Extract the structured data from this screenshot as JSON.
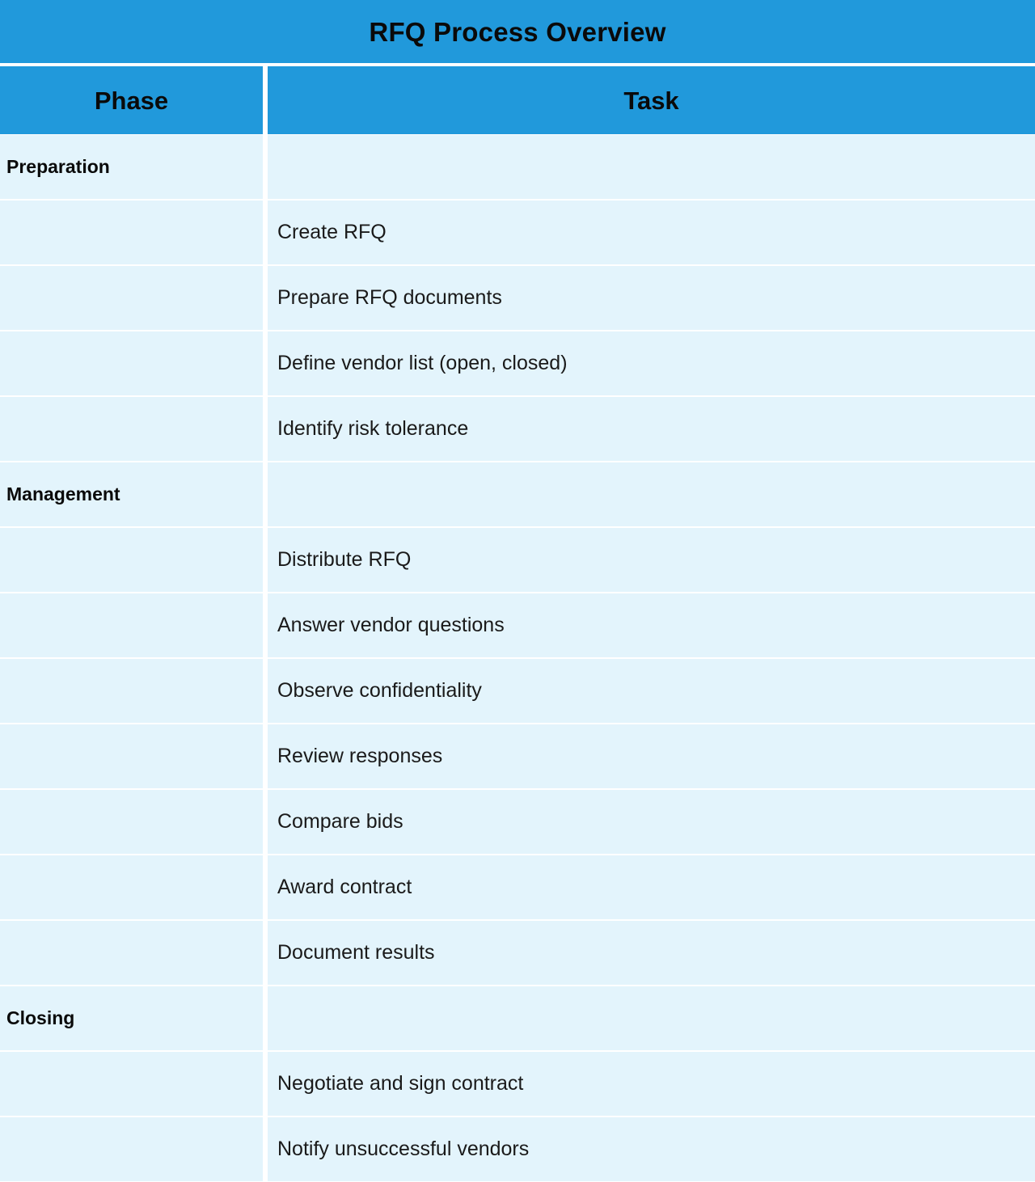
{
  "document": {
    "title": "RFQ Process Overview",
    "accent_color": "#2199db",
    "row_color": "#e3f4fc",
    "text_color": "#0a0a0a"
  },
  "table": {
    "columns": [
      {
        "key": "phase",
        "label": "Phase"
      },
      {
        "key": "task",
        "label": "Task"
      }
    ],
    "rows": [
      {
        "phase": "Preparation",
        "task": ""
      },
      {
        "phase": "",
        "task": "Create RFQ"
      },
      {
        "phase": "",
        "task": "Prepare RFQ documents"
      },
      {
        "phase": "",
        "task": "Define vendor list (open, closed)"
      },
      {
        "phase": "",
        "task": "Identify risk tolerance"
      },
      {
        "phase": "Management",
        "task": ""
      },
      {
        "phase": "",
        "task": "Distribute RFQ"
      },
      {
        "phase": "",
        "task": "Answer vendor questions"
      },
      {
        "phase": "",
        "task": "Observe confidentiality"
      },
      {
        "phase": "",
        "task": "Review responses"
      },
      {
        "phase": "",
        "task": "Compare bids"
      },
      {
        "phase": "",
        "task": "Award contract"
      },
      {
        "phase": "",
        "task": "Document results"
      },
      {
        "phase": "Closing",
        "task": ""
      },
      {
        "phase": "",
        "task": "Negotiate and sign contract"
      },
      {
        "phase": "",
        "task": "Notify unsuccessful vendors"
      }
    ]
  }
}
